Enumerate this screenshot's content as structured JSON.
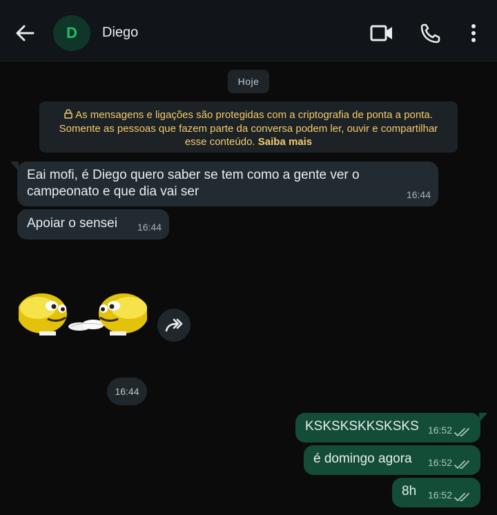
{
  "header": {
    "avatar_letter": "D",
    "contact_name": "Diego",
    "icons": [
      "back-arrow-icon",
      "video-call-icon",
      "voice-call-icon",
      "more-vert-icon"
    ]
  },
  "chat": {
    "date_label": "Hoje",
    "encryption_notice": {
      "line1": "As mensagens e ligações são protegidas com a criptografia de ponta a ponta.",
      "line2": "Somente as pessoas que fazem parte da conversa podem ler, ouvir e compartilhar",
      "line3": "esse conteúdo.",
      "link": "Saiba mais"
    },
    "incoming": [
      {
        "line1": "Eai mofi, é Diego quero saber se tem como a gente ver o",
        "line2": "campeonato e que dia vai ser",
        "time": "16:44"
      },
      {
        "text": "Apoiar o sensei",
        "time": "16:44"
      }
    ],
    "sticker": {
      "time": "16:44"
    },
    "outgoing": [
      {
        "text": "KSKSKSKKSKSKS",
        "time": "16:52"
      },
      {
        "text": "é domingo agora",
        "time": "16:52"
      },
      {
        "text": "8h",
        "time": "16:52"
      }
    ]
  },
  "colors": {
    "header_bg": "#111418",
    "incoming_bubble": "#222b31",
    "outgoing_bubble": "#144d37",
    "notice_text": "#f4cc6b",
    "avatar_text": "#21c063"
  }
}
